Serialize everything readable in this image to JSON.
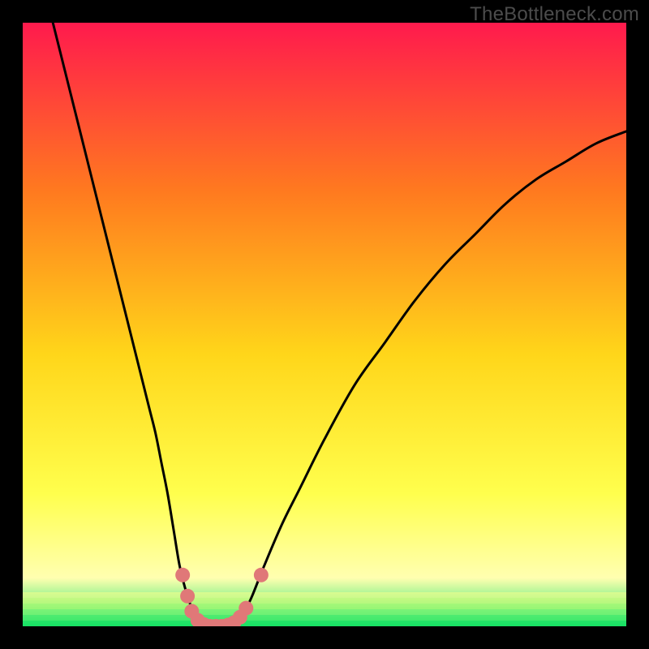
{
  "watermark": "TheBottleneck.com",
  "colors": {
    "frame": "#000000",
    "gradient_top": "#ff1a4d",
    "gradient_mid1": "#ff7a1f",
    "gradient_mid2": "#ffd61a",
    "gradient_mid3": "#ffff4d",
    "gradient_pale": "#ffffb0",
    "gradient_bottom": "#00e060",
    "curve": "#000000",
    "marker": "#e07878"
  },
  "chart_data": {
    "type": "line",
    "title": "",
    "xlabel": "",
    "ylabel": "",
    "x_range": [
      0,
      100
    ],
    "y_range": [
      0,
      100
    ],
    "curve_left": [
      {
        "x": 5.0,
        "y": 100
      },
      {
        "x": 6.0,
        "y": 96
      },
      {
        "x": 8.0,
        "y": 88
      },
      {
        "x": 10.0,
        "y": 80
      },
      {
        "x": 12.0,
        "y": 72
      },
      {
        "x": 14.0,
        "y": 64
      },
      {
        "x": 16.0,
        "y": 56
      },
      {
        "x": 18.0,
        "y": 48
      },
      {
        "x": 20.0,
        "y": 40
      },
      {
        "x": 21.0,
        "y": 36
      },
      {
        "x": 22.0,
        "y": 32
      },
      {
        "x": 23.0,
        "y": 27
      },
      {
        "x": 24.0,
        "y": 22
      },
      {
        "x": 25.0,
        "y": 16
      },
      {
        "x": 26.0,
        "y": 10
      },
      {
        "x": 27.0,
        "y": 6
      },
      {
        "x": 28.0,
        "y": 3
      },
      {
        "x": 29.0,
        "y": 1
      },
      {
        "x": 30.0,
        "y": 0
      }
    ],
    "curve_right": [
      {
        "x": 30.0,
        "y": 0
      },
      {
        "x": 31.0,
        "y": 0
      },
      {
        "x": 32.0,
        "y": 0
      },
      {
        "x": 33.0,
        "y": 0
      },
      {
        "x": 34.0,
        "y": 0
      },
      {
        "x": 35.0,
        "y": 0.5
      },
      {
        "x": 36.0,
        "y": 1.5
      },
      {
        "x": 37.0,
        "y": 3
      },
      {
        "x": 38.0,
        "y": 5
      },
      {
        "x": 40.0,
        "y": 10
      },
      {
        "x": 43.0,
        "y": 17
      },
      {
        "x": 46.0,
        "y": 23
      },
      {
        "x": 50.0,
        "y": 31
      },
      {
        "x": 55.0,
        "y": 40
      },
      {
        "x": 60.0,
        "y": 47
      },
      {
        "x": 65.0,
        "y": 54
      },
      {
        "x": 70.0,
        "y": 60
      },
      {
        "x": 75.0,
        "y": 65
      },
      {
        "x": 80.0,
        "y": 70
      },
      {
        "x": 85.0,
        "y": 74
      },
      {
        "x": 90.0,
        "y": 77
      },
      {
        "x": 95.0,
        "y": 80
      },
      {
        "x": 100.0,
        "y": 82
      }
    ],
    "markers": [
      {
        "x": 26.5,
        "y": 8.5
      },
      {
        "x": 27.3,
        "y": 5.0
      },
      {
        "x": 28.0,
        "y": 2.5
      },
      {
        "x": 29.0,
        "y": 1.0
      },
      {
        "x": 30.0,
        "y": 0.3
      },
      {
        "x": 31.0,
        "y": 0.0
      },
      {
        "x": 32.0,
        "y": 0.0
      },
      {
        "x": 33.0,
        "y": 0.0
      },
      {
        "x": 34.0,
        "y": 0.2
      },
      {
        "x": 35.0,
        "y": 0.6
      },
      {
        "x": 36.0,
        "y": 1.5
      },
      {
        "x": 37.0,
        "y": 3.0
      },
      {
        "x": 39.5,
        "y": 8.5
      }
    ]
  }
}
